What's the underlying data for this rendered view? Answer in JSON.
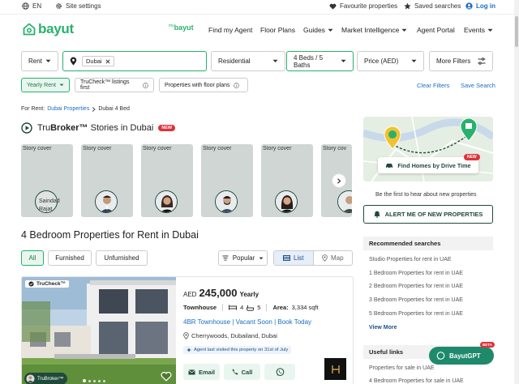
{
  "topbar": {
    "language": "EN",
    "site_settings": "Site settings",
    "favourite": "Favourite properties",
    "saved_searches": "Saved searches",
    "login": "Log in"
  },
  "nav": {
    "logo": "bayut",
    "sub_logo_small": "my",
    "sub_logo": "bayut",
    "find_agent": "Find my Agent",
    "floor_plans": "Floor Plans",
    "guides": "Guides",
    "market": "Market Intelligence",
    "agent_portal": "Agent Portal",
    "events": "Events"
  },
  "filters": {
    "purpose": "For Rent",
    "purpose_short": "Rent",
    "location_chip": "Dubai",
    "category": "Residential",
    "beds_baths": "4 Beds / 5 Baths",
    "price": "Price (AED)",
    "more": "More Filters",
    "yearly_rent": "Yearly Rent",
    "trucheck": "TruCheck™ listings first",
    "floor_plans": "Properties with floor plans",
    "clear": "Clear Filters",
    "save": "Save Search"
  },
  "breadcrumb": {
    "root": "For Rent:",
    "level1": "Dubai Properties",
    "level2": "Dubai 4 Bed"
  },
  "stories": {
    "title_prefix": "Tru",
    "title_brand": "Broker™",
    "title_suffix": " Stories in Dubai",
    "new": "NEW",
    "items": [
      {
        "caption": "Story cover",
        "avatar_text": "Saindad Rajat"
      },
      {
        "caption": "Story cover"
      },
      {
        "caption": "Story cover"
      },
      {
        "caption": "Story cover"
      },
      {
        "caption": "Story cover"
      },
      {
        "caption": "Story cov"
      }
    ]
  },
  "results": {
    "title": "4 Bedroom Properties for Rent in Dubai",
    "tabs": [
      "All",
      "Furnished",
      "Unfurnished"
    ],
    "sort": "Popular",
    "view_list": "List",
    "view_map": "Map"
  },
  "listing": {
    "badge": "TruCheck™",
    "agent_badge": "TruBroker™",
    "currency": "AED",
    "price": "245,000",
    "period": "Yearly",
    "type": "Townhouse",
    "beds": "4",
    "baths": "5",
    "area_label": "Area:",
    "area": "3,334 sqft",
    "headline": "4BR Townhouse | Vacant Soon | Book Today",
    "location": "Cherrywoods, Dubailand, Dubai",
    "visit_note": "Agent last visited this property on 31st of July",
    "email": "Email",
    "call": "Call"
  },
  "sidebar": {
    "map_cta": "Find Homes by Drive Time",
    "map_new": "NEW",
    "alert_lead": "Be the first to hear about new properties",
    "alert_btn": "ALERT ME OF NEW PROPERTIES",
    "recommended_title": "Recommended searches",
    "recommended": [
      "Studio Properties for rent in UAE",
      "1 Bedroom Properties for rent in UAE",
      "2 Bedroom Properties for rent in UAE",
      "3 Bedroom Properties for rent in UAE",
      "5 Bedroom Properties for rent in UAE"
    ],
    "view_more": "View More",
    "useful_title": "Useful links",
    "useful": [
      "Properties for sale in UAE",
      "4 Bedroom Properties for sale in UAE"
    ]
  },
  "gpt": {
    "label": "BayutGPT",
    "beta": "BETA"
  },
  "colors": {
    "brand_green": "#28b16d",
    "dark_green": "#1f4a3a",
    "link_blue": "#1b6ec2",
    "badge_red": "#e0313a"
  }
}
